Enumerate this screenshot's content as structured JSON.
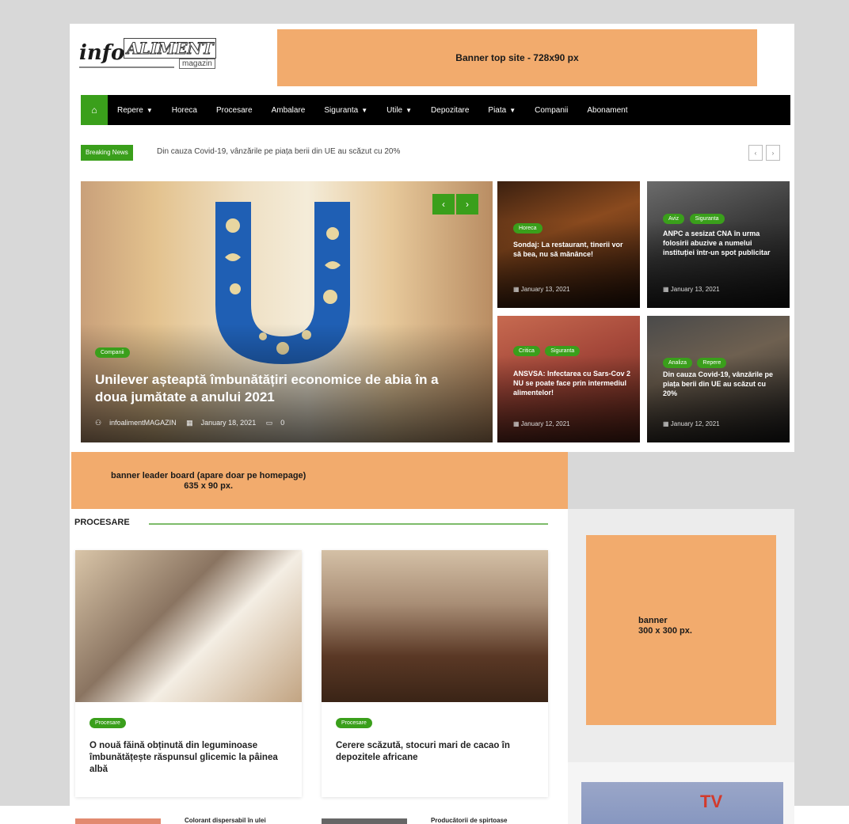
{
  "header": {
    "logo_info": "info",
    "logo_aliment": "ALIMENT",
    "logo_magazin": "magazin",
    "banner_top": "Banner top site - 728x90 px"
  },
  "nav": {
    "items": [
      {
        "label": "Repere",
        "caret": "▼"
      },
      {
        "label": "Horeca",
        "caret": ""
      },
      {
        "label": "Procesare",
        "caret": ""
      },
      {
        "label": "Ambalare",
        "caret": ""
      },
      {
        "label": "Siguranta",
        "caret": "▼"
      },
      {
        "label": "Utile",
        "caret": "▼"
      },
      {
        "label": "Depozitare",
        "caret": ""
      },
      {
        "label": "Piata",
        "caret": "▼"
      },
      {
        "label": "Companii",
        "caret": ""
      },
      {
        "label": "Abonament",
        "caret": ""
      }
    ]
  },
  "breaking": {
    "label": "Breaking News",
    "text": "Din cauza Covid-19, vânzările pe piața berii din UE au scăzut cu 20%"
  },
  "hero": {
    "category": "Companii",
    "title": "Unilever așteaptă îmbunătățiri economice de abia în a doua jumătate a anului 2021",
    "author": "infoalimentMAGAZIN",
    "date": "January 18, 2021",
    "comments": "0"
  },
  "cards": [
    {
      "cats": [
        "Horeca"
      ],
      "title": "Sondaj: La restaurant, tinerii vor să bea, nu să mănânce!",
      "date": "January 13, 2021"
    },
    {
      "cats": [
        "Aviz",
        "Siguranta"
      ],
      "title": "ANPC a sesizat CNA în urma folosirii abuzive a numelui instituției într-un spot publicitar",
      "date": "January 13, 2021"
    },
    {
      "cats": [
        "Critica",
        "Siguranta"
      ],
      "title": "ANSVSA: Infectarea cu Sars-Cov 2 NU se poate face prin intermediul alimentelor!",
      "date": "January 12, 2021"
    },
    {
      "cats": [
        "Analiza",
        "Repere"
      ],
      "title": "Din cauza Covid-19, vânzările pe piața berii din UE au scăzut cu 20%",
      "date": "January 12, 2021"
    }
  ],
  "leaderboard": {
    "line1": "banner leader board (apare doar pe homepage)",
    "line2": "635 x 90 px."
  },
  "section": {
    "title": "PROCESARE",
    "posts": [
      {
        "category": "Procesare",
        "title": "O nouă făină obținută din leguminoase îmbunătățește răspunsul glicemic la pâinea albă"
      },
      {
        "category": "Procesare",
        "title": "Cerere scăzută, stocuri mari de cacao în depozitele africane"
      }
    ]
  },
  "sidebar": {
    "banner_line1": "banner",
    "banner_line2": "300 x 300 px.",
    "tv": "TV"
  },
  "below": [
    {
      "title": "Colorant dispersabil în ulei"
    },
    {
      "title": "Producătorii de spirtoase"
    }
  ]
}
